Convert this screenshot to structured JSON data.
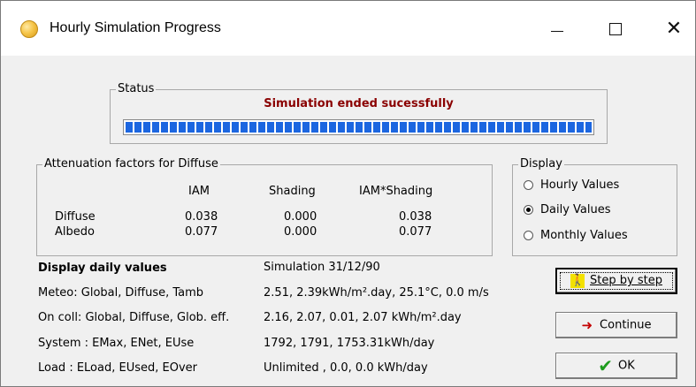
{
  "window": {
    "title": "Hourly Simulation Progress",
    "minimize_icon": "minimize-icon",
    "maximize_icon": "maximize-icon",
    "close_icon": "close-icon"
  },
  "status": {
    "group_label": "Status",
    "message": "Simulation ended sucessfully",
    "progress_fraction": 1.0,
    "accent_color": "#8a0000",
    "bar_color": "#1c66e0"
  },
  "attenuation": {
    "group_label": "Attenuation factors for Diffuse",
    "columns": [
      "IAM",
      "Shading",
      "IAM*Shading"
    ],
    "rows": [
      {
        "label": "Diffuse",
        "values": [
          "0.038",
          "0.000",
          "0.038"
        ]
      },
      {
        "label": "Albedo",
        "values": [
          "0.077",
          "0.000",
          "0.077"
        ]
      }
    ]
  },
  "display": {
    "group_label": "Display",
    "options": [
      {
        "label": "Hourly Values",
        "checked": false
      },
      {
        "label": "Daily Values",
        "checked": true
      },
      {
        "label": "Monthly Values",
        "checked": false
      }
    ]
  },
  "info": {
    "heading": "Display daily values",
    "simulation_label": "Simulation 31/12/90",
    "lines": [
      {
        "label": "Meteo:  Global,  Diffuse, Tamb",
        "value": "2.51,  2.39kWh/m².day,  25.1°C,  0.0 m/s"
      },
      {
        "label": "On coll: Global,  Diffuse, Glob. eff.",
        "value": "2.16,  2.07,  0.01,  2.07 kWh/m².day"
      },
      {
        "label": "System : EMax, ENet, EUse",
        "value": "1792,  1791,  1753.31kWh/day"
      },
      {
        "label": "Load :  ELoad, EUsed, EOver",
        "value": "Unlimited , 0.0,  0.0 kWh/day"
      }
    ]
  },
  "buttons": {
    "step_label": "Step by step",
    "step_icon": "walker-icon",
    "continue_label": "Continue",
    "continue_icon": "arrow-right-icon",
    "ok_label": "OK",
    "ok_icon": "check-icon"
  }
}
